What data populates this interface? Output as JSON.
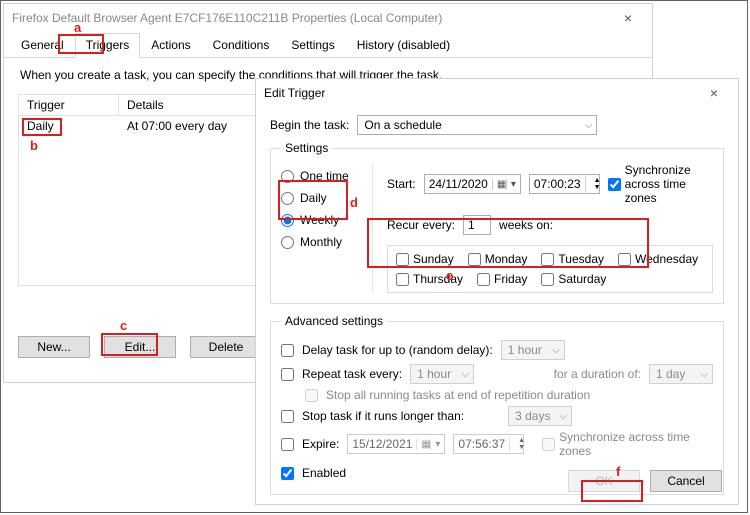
{
  "propWin": {
    "title": "Firefox Default Browser Agent E7CF176E110C211B Properties (Local Computer)",
    "tabs": [
      "General",
      "Triggers",
      "Actions",
      "Conditions",
      "Settings",
      "History (disabled)"
    ],
    "description": "When you create a task, you can specify the conditions that will trigger the task.",
    "cols": {
      "trigger": "Trigger",
      "details": "Details",
      "dummy": ""
    },
    "row": {
      "trigger": "Daily",
      "details": "At 07:00 every day"
    },
    "buttons": {
      "new": "New...",
      "edit": "Edit...",
      "delete": "Delete"
    }
  },
  "editWin": {
    "title": "Edit Trigger",
    "beginLabel": "Begin the task:",
    "beginValue": "On a schedule",
    "settingsLegend": "Settings",
    "radios": {
      "one": "One time",
      "daily": "Daily",
      "weekly": "Weekly",
      "monthly": "Monthly"
    },
    "startLabel": "Start:",
    "startDate": "24/11/2020",
    "startTime": "07:00:23",
    "syncTZ": "Synchronize across time zones",
    "recurLabel": "Recur every:",
    "recurVal": "1",
    "recurUnit": "weeks on:",
    "days": {
      "sun": "Sunday",
      "mon": "Monday",
      "tue": "Tuesday",
      "wed": "Wednesday",
      "thu": "Thursday",
      "fri": "Friday",
      "sat": "Saturday"
    },
    "advLegend": "Advanced settings",
    "delayLabel": "Delay task for up to (random delay):",
    "delayVal": "1 hour",
    "repeatLabel": "Repeat task every:",
    "repeatVal": "1 hour",
    "durationLabel": "for a duration of:",
    "durationVal": "1 day",
    "stopAll": "Stop all running tasks at end of repetition duration",
    "stopIfLabel": "Stop task if it runs longer than:",
    "stopIfVal": "3 days",
    "expireLabel": "Expire:",
    "expireDate": "15/12/2021",
    "expireTime": "07:56:37",
    "enabled": "Enabled",
    "ok": "OK",
    "cancel": "Cancel"
  },
  "ann": {
    "a": "a",
    "b": "b",
    "c": "c",
    "d": "d",
    "e": "e",
    "f": "f"
  }
}
